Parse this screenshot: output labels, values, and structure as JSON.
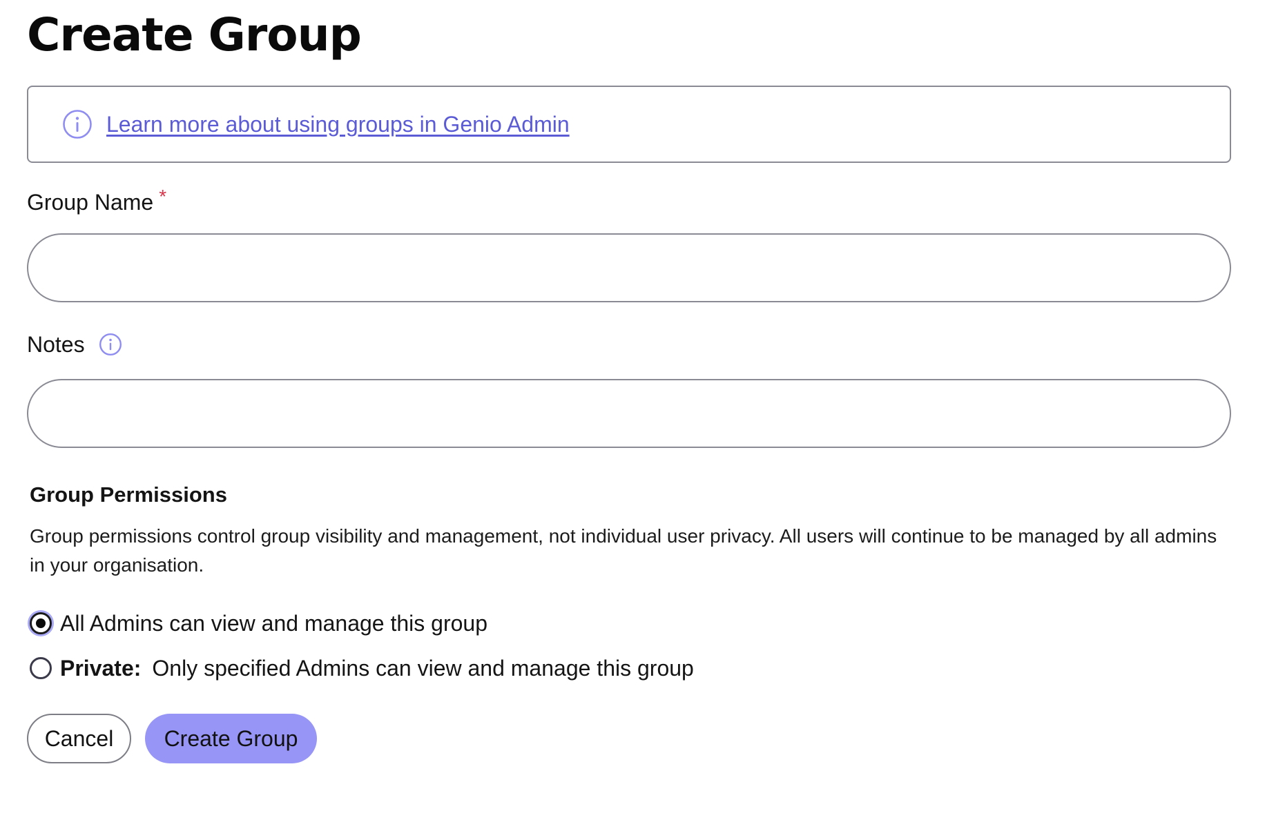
{
  "page": {
    "title": "Create Group"
  },
  "banner": {
    "icon": "info-circle-icon",
    "link_text": "Learn more about using groups in Genio Admin"
  },
  "form": {
    "group_name": {
      "label": "Group Name",
      "required_mark": "*",
      "value": "",
      "placeholder": ""
    },
    "notes": {
      "label": "Notes",
      "icon": "info-circle-icon",
      "value": "",
      "placeholder": ""
    }
  },
  "permissions": {
    "heading": "Group Permissions",
    "description": "Group permissions control group visibility and management, not individual user privacy. All users will continue to be managed by all admins in your organisation.",
    "options": [
      {
        "label": "All Admins can view and manage this group",
        "selected": true
      },
      {
        "bold_prefix": "Private:",
        "label": "Only specified Admins can view and manage this group",
        "selected": false
      }
    ]
  },
  "actions": {
    "cancel_label": "Cancel",
    "create_label": "Create Group"
  },
  "colors": {
    "accent": "#9795f5",
    "link": "#5b5bd6",
    "required": "#d9344a",
    "border": "#8a8a94"
  }
}
